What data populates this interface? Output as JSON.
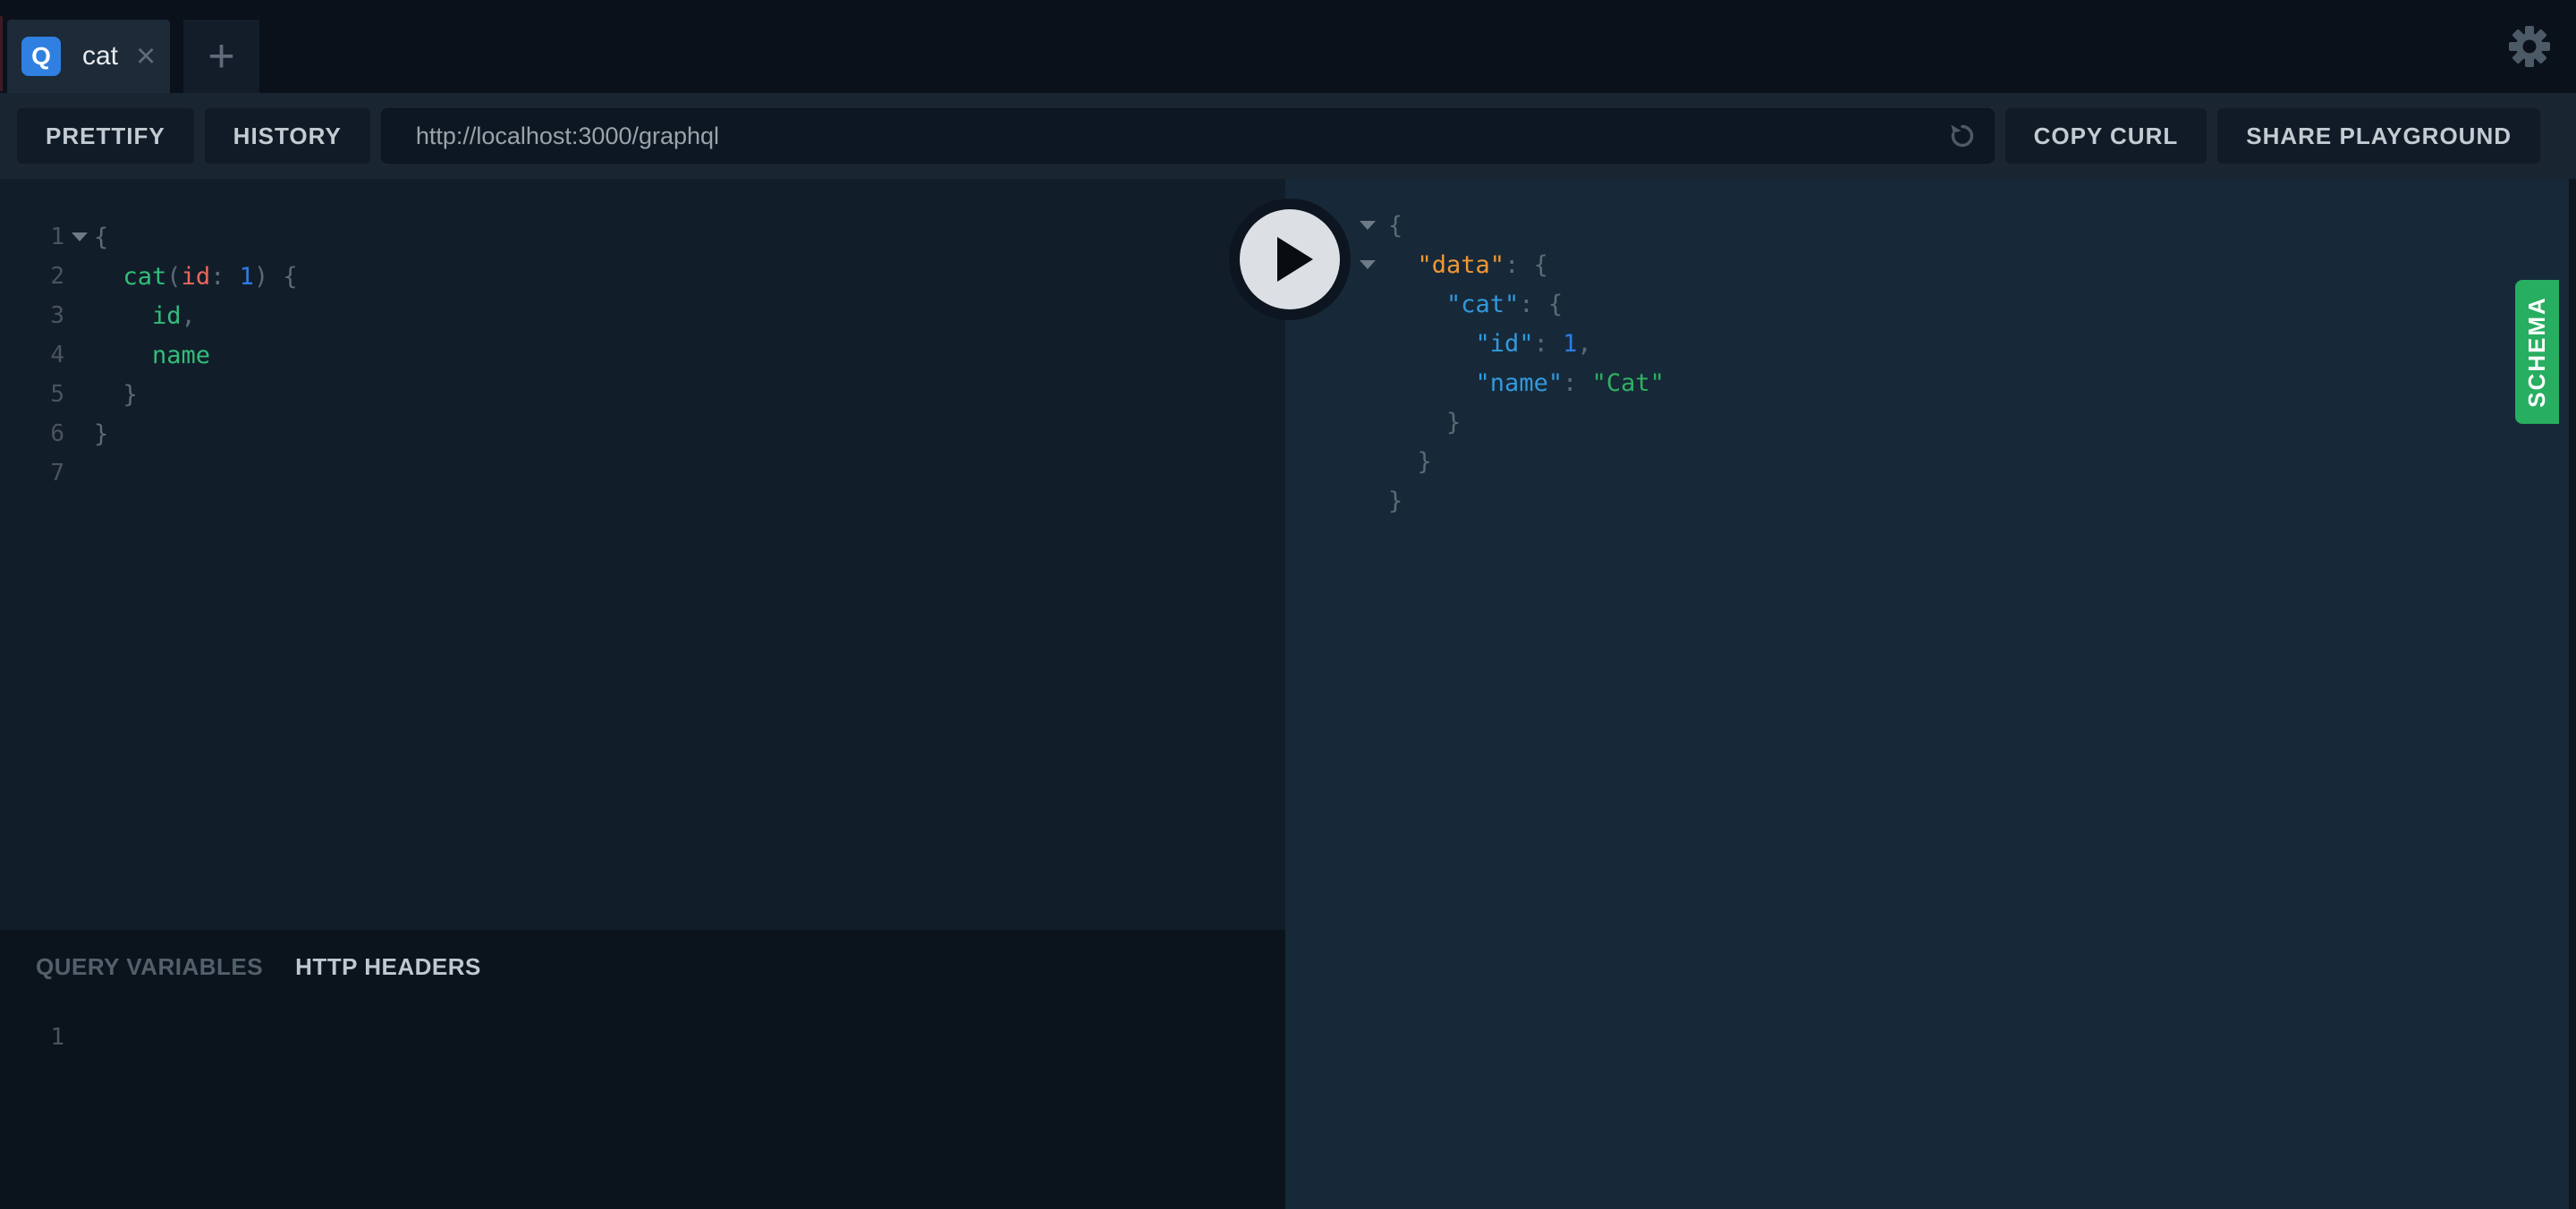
{
  "tabbar": {
    "tab": {
      "badge": "Q",
      "label": "cat",
      "close_glyph": "×"
    },
    "new_tab_glyph": "+"
  },
  "toolbar": {
    "prettify_label": "PRETTIFY",
    "history_label": "HISTORY",
    "url": "http://localhost:3000/graphql",
    "copy_curl_label": "COPY CURL",
    "share_label": "SHARE PLAYGROUND"
  },
  "schema_tab_label": "SCHEMA",
  "bottom_panel": {
    "query_variables_label": "QUERY VARIABLES",
    "http_headers_label": "HTTP HEADERS",
    "line_number": "1"
  },
  "colors": {
    "accent_blue": "#2F80E0",
    "schema_green": "#27AE60",
    "punct": "#5D6A76",
    "field": "#33BD7A",
    "arg": "#E9685C",
    "num": "#2D7CE4",
    "key": "#3399DC",
    "key_root": "#F19834",
    "str": "#30B062"
  },
  "query_editor": {
    "lines": [
      {
        "n": "1",
        "fold": true,
        "tokens": [
          {
            "t": "{",
            "c": "punct"
          }
        ]
      },
      {
        "n": "2",
        "fold": false,
        "tokens": [
          {
            "t": "  "
          },
          {
            "t": "cat",
            "c": "field"
          },
          {
            "t": "(",
            "c": "punct"
          },
          {
            "t": "id",
            "c": "arg"
          },
          {
            "t": ":",
            "c": "punct"
          },
          {
            "t": " "
          },
          {
            "t": "1",
            "c": "num"
          },
          {
            "t": ")",
            "c": "punct"
          },
          {
            "t": " ",
            "c": "punct"
          },
          {
            "t": "{",
            "c": "punct"
          }
        ]
      },
      {
        "n": "3",
        "fold": false,
        "tokens": [
          {
            "t": "    "
          },
          {
            "t": "id",
            "c": "field"
          },
          {
            "t": ",",
            "c": "punct"
          }
        ]
      },
      {
        "n": "4",
        "fold": false,
        "tokens": [
          {
            "t": "    "
          },
          {
            "t": "name",
            "c": "field"
          }
        ]
      },
      {
        "n": "5",
        "fold": false,
        "tokens": [
          {
            "t": "  }",
            "c": "punct"
          }
        ]
      },
      {
        "n": "6",
        "fold": false,
        "tokens": [
          {
            "t": "}",
            "c": "punct"
          }
        ]
      },
      {
        "n": "7",
        "fold": false,
        "tokens": []
      }
    ]
  },
  "result_viewer": {
    "lines": [
      {
        "fold": true,
        "tokens": [
          {
            "t": "{",
            "c": "punct"
          }
        ]
      },
      {
        "fold": true,
        "tokens": [
          {
            "t": "  "
          },
          {
            "t": "\"data\"",
            "c": "key_root"
          },
          {
            "t": ":",
            "c": "punct"
          },
          {
            "t": " "
          },
          {
            "t": "{",
            "c": "punct"
          }
        ]
      },
      {
        "fold": false,
        "tokens": [
          {
            "t": "    "
          },
          {
            "t": "\"cat\"",
            "c": "key"
          },
          {
            "t": ":",
            "c": "punct"
          },
          {
            "t": " "
          },
          {
            "t": "{",
            "c": "punct"
          }
        ]
      },
      {
        "fold": false,
        "tokens": [
          {
            "t": "      "
          },
          {
            "t": "\"id\"",
            "c": "key"
          },
          {
            "t": ":",
            "c": "punct"
          },
          {
            "t": " "
          },
          {
            "t": "1",
            "c": "num"
          },
          {
            "t": ",",
            "c": "punct"
          }
        ]
      },
      {
        "fold": false,
        "tokens": [
          {
            "t": "      "
          },
          {
            "t": "\"name\"",
            "c": "key"
          },
          {
            "t": ":",
            "c": "punct"
          },
          {
            "t": " "
          },
          {
            "t": "\"Cat\"",
            "c": "str"
          }
        ]
      },
      {
        "fold": false,
        "tokens": [
          {
            "t": "    }",
            "c": "punct"
          }
        ]
      },
      {
        "fold": false,
        "tokens": [
          {
            "t": "  }",
            "c": "punct"
          }
        ]
      },
      {
        "fold": false,
        "tokens": [
          {
            "t": "}",
            "c": "punct"
          }
        ]
      }
    ]
  }
}
